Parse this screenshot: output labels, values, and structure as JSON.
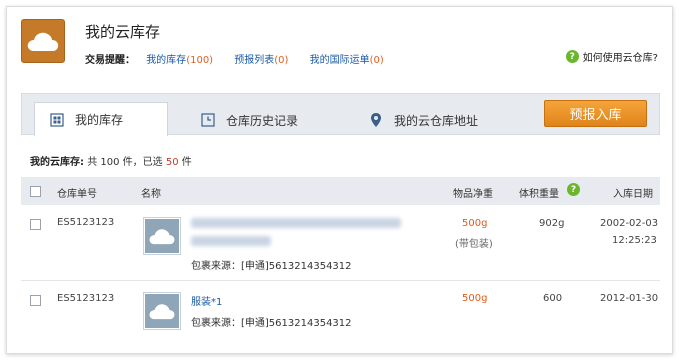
{
  "header": {
    "title": "我的云库存",
    "reminder_label": "交易提醒：",
    "links": [
      {
        "label": "我的库存",
        "count": "(100)"
      },
      {
        "label": "预报列表",
        "count": "(0)"
      },
      {
        "label": "我的国际运单",
        "count": "(0)"
      }
    ],
    "help_label": "如何使用云仓库?"
  },
  "tabs": [
    {
      "label": "我的库存",
      "icon": "grid-icon",
      "active": true
    },
    {
      "label": "仓库历史记录",
      "icon": "clock-icon",
      "active": false
    },
    {
      "label": "我的云仓库地址",
      "icon": "location-pin-icon",
      "active": false
    }
  ],
  "prereport_button": "预报入库",
  "summary": {
    "label": "我的云库存:",
    "total_text": "共 100 件，已选",
    "selected": "50",
    "unit": "件"
  },
  "table": {
    "headers": {
      "order_no": "仓库单号",
      "name": "名称",
      "net_weight": "物品净重",
      "volume_weight": "体积重量",
      "date": "入库日期"
    },
    "rows": [
      {
        "order_no": "ES5123123",
        "name": "",
        "source": "包裹来源：[申通]5613214354312",
        "net_weight": "500g",
        "weight_note": "(带包装)",
        "volume_weight": "902g",
        "date": "2002-02-03",
        "time": "12:25:23"
      },
      {
        "order_no": "ES5123123",
        "name": "服装*1",
        "source": "包裹来源：[申通]5613214354312",
        "net_weight": "500g",
        "weight_note": "",
        "volume_weight": "600",
        "date": "2012-01-30",
        "time": ""
      }
    ]
  },
  "colors": {
    "accent_orange": "#e0841a",
    "link_blue": "#1a5aa6",
    "count_orange": "#e06020",
    "help_green": "#6ab62d"
  }
}
